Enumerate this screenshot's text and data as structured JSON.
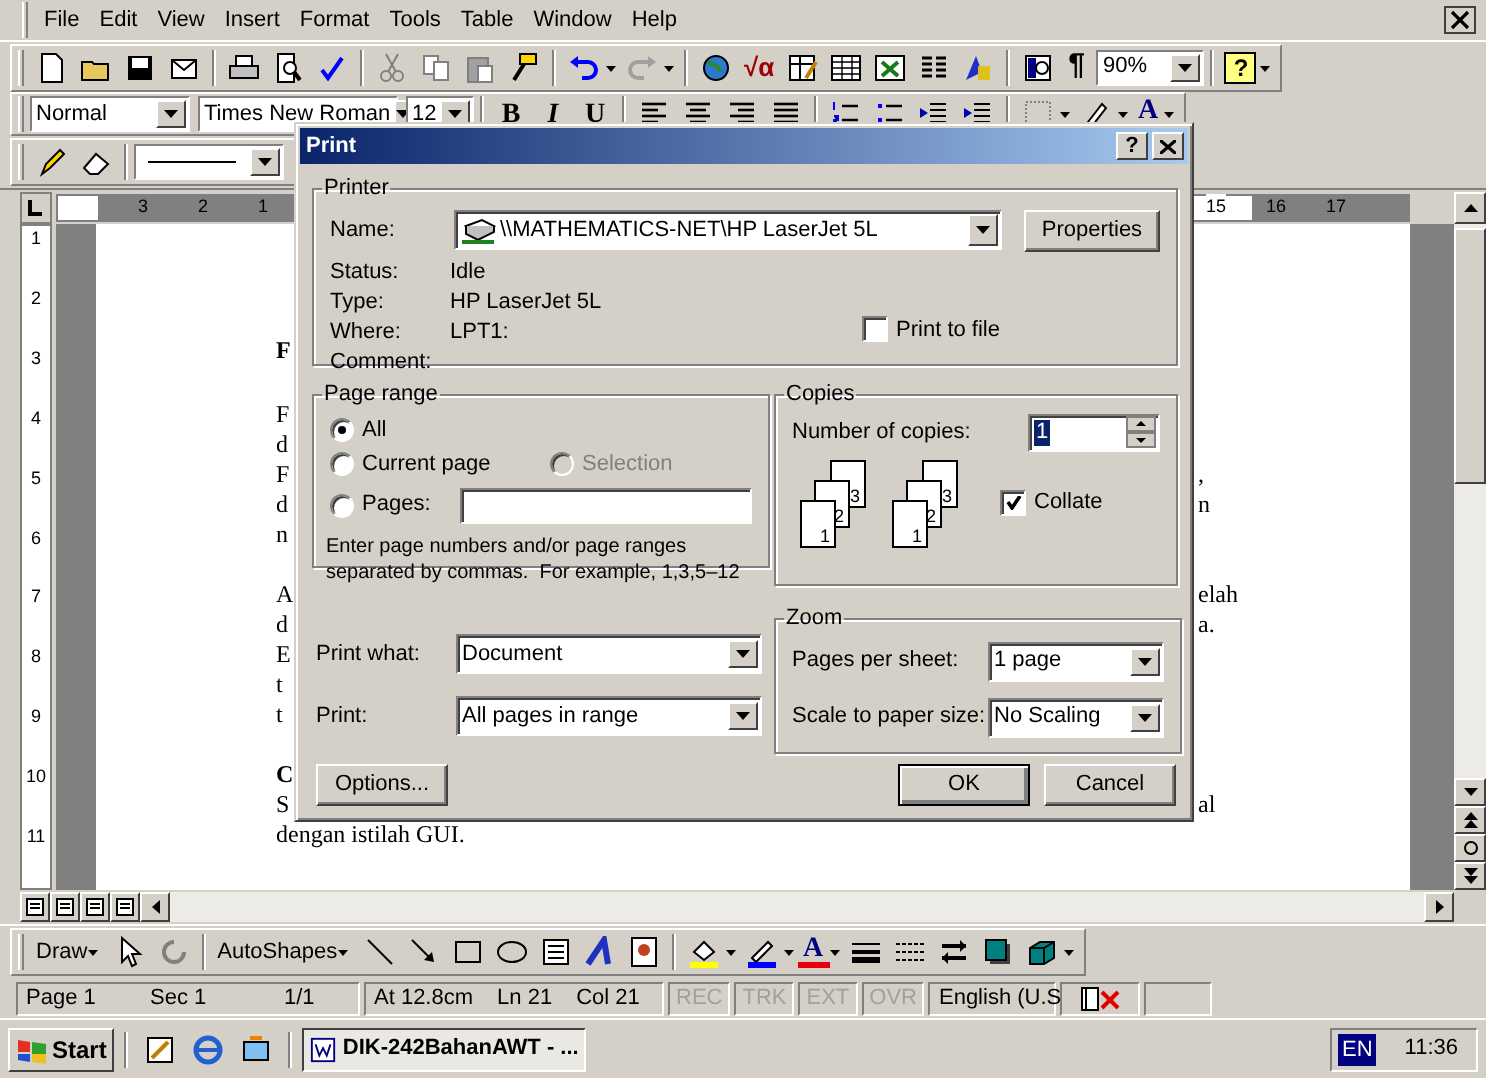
{
  "menu_bar": {
    "items": [
      "File",
      "Edit",
      "View",
      "Insert",
      "Format",
      "Tools",
      "Table",
      "Window",
      "Help"
    ]
  },
  "standard_toolbar": {
    "equation": "√α",
    "show_hide": "¶",
    "zoom": "90%",
    "help": "?"
  },
  "formatting_toolbar": {
    "style": "Normal",
    "font": "Times New Roman",
    "size": "12",
    "bold": "B",
    "italic": "I",
    "underline": "U",
    "font_color": "A"
  },
  "ruler": {
    "left_marks": [
      "3",
      "2",
      "1"
    ],
    "right_marks": [
      "15",
      "16",
      "17"
    ],
    "vertical_marks": [
      "1",
      "2",
      "3",
      "4",
      "5",
      "6",
      "7",
      "8",
      "9",
      "10",
      "11"
    ]
  },
  "document": {
    "paragraphs": [
      {
        "lines": [
          {
            "left": "F",
            "bold": true
          }
        ]
      },
      {
        "lines": [
          {
            "left": "F",
            "bold": false
          },
          {
            "left": "d",
            "bold": false
          },
          {
            "left": "F",
            "right": ",",
            "bold": false
          },
          {
            "left": "d",
            "right": "n",
            "bold": false
          },
          {
            "left": "n",
            "bold": false
          }
        ]
      },
      {
        "lines": [
          {
            "left": "A",
            "right": "elah",
            "bold": false
          },
          {
            "left": "d",
            "right": "a.",
            "bold": false
          },
          {
            "left": "E",
            "bold": false
          },
          {
            "left": "t",
            "bold": false
          },
          {
            "left": "t",
            "bold": false
          }
        ]
      },
      {
        "lines": [
          {
            "left": "C",
            "bold": true
          },
          {
            "left": "S",
            "right": "al",
            "bold": false
          },
          {
            "left": "dengan istilah GUI.",
            "bold": false
          }
        ]
      }
    ]
  },
  "print_dialog": {
    "title": "Print",
    "help": "?",
    "printer": {
      "title": "Printer",
      "name_label": "Name:",
      "name": "\\\\MATHEMATICS-NET\\HP LaserJet 5L",
      "properties": "Properties",
      "info": [
        {
          "label": "Status:",
          "value": "Idle"
        },
        {
          "label": "Type:",
          "value": "HP LaserJet 5L"
        },
        {
          "label": "Where:",
          "value": "LPT1:"
        },
        {
          "label": "Comment:"
        }
      ],
      "print_to_file": {
        "label": "Print to file",
        "checked": false
      }
    },
    "page_range": {
      "title": "Page range",
      "options": [
        {
          "label": "All",
          "selected": true,
          "disabled": false
        },
        {
          "label": "Current page",
          "selected": false,
          "disabled": false
        },
        {
          "label": "Selection",
          "selected": false,
          "disabled": true
        },
        {
          "label": "Pages:",
          "selected": false,
          "disabled": false
        }
      ],
      "hint": "Enter page numbers and/or page ranges\nseparated by commas.  For example, 1,3,5–12"
    },
    "copies": {
      "title": "Copies",
      "label": "Number of copies:",
      "value": "1",
      "value_selected": true,
      "stacks": [
        [
          "3",
          "2",
          "1"
        ],
        [
          "3",
          "2",
          "1"
        ]
      ],
      "collate": {
        "label": "Collate",
        "checked": true
      }
    },
    "print_what": {
      "label": "Print what:",
      "value": "Document"
    },
    "print": {
      "label": "Print:",
      "value": "All pages in range"
    },
    "zoom": {
      "title": "Zoom",
      "pages_label": "Pages per sheet:",
      "pages": "1 page",
      "scale_label": "Scale to paper size:",
      "scale": "No Scaling"
    },
    "buttons": [
      {
        "label": "Options...",
        "default": false
      },
      {
        "label": "OK",
        "default": true
      },
      {
        "label": "Cancel",
        "default": false
      }
    ]
  },
  "draw_toolbar": {
    "draw": "Draw",
    "autoshapes": "AutoShapes",
    "font_color": "A"
  },
  "status_bar": {
    "page": "Page 1",
    "section": "Sec 1",
    "pages": "1/1",
    "at": "At 12.8cm",
    "line": "Ln 21",
    "column": "Col 21",
    "modes": [
      {
        "label": "REC",
        "on": false
      },
      {
        "label": "TRK",
        "on": false
      },
      {
        "label": "EXT",
        "on": false
      },
      {
        "label": "OVR",
        "on": false
      }
    ],
    "language": "English (U.S"
  },
  "taskbar": {
    "start": "Start",
    "tasks": [
      {
        "label": "DIK-242BahanAWT - ...",
        "selected": true
      }
    ],
    "input_language": "EN",
    "clock": "11:36"
  }
}
